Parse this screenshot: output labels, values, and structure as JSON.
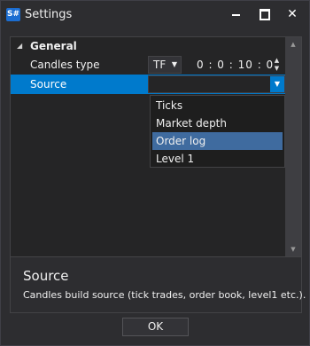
{
  "window": {
    "app_icon_text": "S#",
    "title": "Settings",
    "minimize_glyph": "—",
    "close_glyph": "✕"
  },
  "grid": {
    "group": {
      "label": "General",
      "expanded": true
    },
    "rows": [
      {
        "name": "Candles type",
        "combo_value": "TF",
        "time_value": "0 : 0 : 10 : 0"
      },
      {
        "name": "Source",
        "value": ""
      }
    ]
  },
  "dropdown": {
    "items": [
      "Ticks",
      "Market depth",
      "Order log",
      "Level 1"
    ],
    "selected": "Order log"
  },
  "description": {
    "title": "Source",
    "text": "Candles build source (tick trades, order book, level1 etc.)."
  },
  "footer": {
    "ok_label": "OK"
  },
  "colors": {
    "background": "#2d2d30",
    "accent": "#007acc",
    "selection": "#3f6b9f"
  },
  "icons": [
    "app-icon",
    "minimize-icon",
    "maximize-icon",
    "close-icon",
    "collapse-arrow-icon",
    "chevron-down-icon",
    "spin-up-icon",
    "spin-down-icon",
    "scroll-up-icon",
    "scroll-down-icon"
  ]
}
